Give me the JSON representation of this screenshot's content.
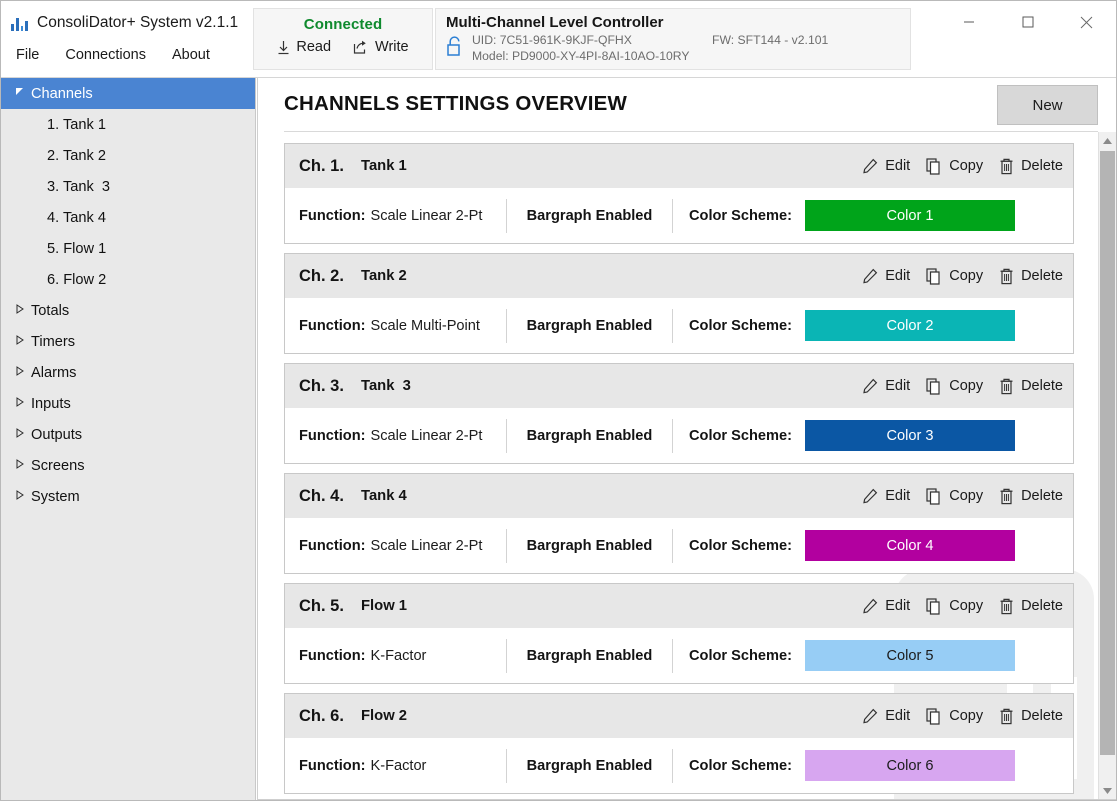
{
  "window": {
    "title": "ConsoliDator+ System v2.1.1",
    "logo_icon": "bar-chart-logo-icon",
    "minimize_icon": "minimize-icon",
    "maximize_icon": "maximize-icon",
    "close_icon": "close-icon"
  },
  "menubar": {
    "items": [
      {
        "label": "File"
      },
      {
        "label": "Connections"
      },
      {
        "label": "About"
      }
    ]
  },
  "connection": {
    "status": "Connected",
    "status_color": "#0f8a2e",
    "read_label": "Read",
    "read_icon": "download-arrow-icon",
    "write_label": "Write",
    "write_icon": "share-arrow-icon"
  },
  "device": {
    "name": "Multi-Channel Level Controller",
    "lock_icon": "unlocked-padlock-icon",
    "uid": "UID: 7C51-961K-9KJF-QFHX",
    "fw": "FW: SFT144 - v2.101",
    "model": "Model: PD9000-XY-4PI-8AI-10AO-10RY"
  },
  "sidebar": {
    "items": [
      {
        "label": "Channels",
        "arrow": "▲",
        "level": 0,
        "selected": true,
        "expanded": true
      },
      {
        "label": "1. Tank 1",
        "level": 1,
        "selected": false
      },
      {
        "label": "2. Tank 2",
        "level": 1,
        "selected": false
      },
      {
        "label": "3. Tank  3",
        "level": 1,
        "selected": false
      },
      {
        "label": "4. Tank 4",
        "level": 1,
        "selected": false
      },
      {
        "label": "5. Flow 1",
        "level": 1,
        "selected": false
      },
      {
        "label": "6. Flow 2",
        "level": 1,
        "selected": false
      },
      {
        "label": "Totals",
        "arrow": "▷",
        "level": 0,
        "selected": false,
        "expanded": false
      },
      {
        "label": "Timers",
        "arrow": "▷",
        "level": 0,
        "selected": false,
        "expanded": false
      },
      {
        "label": "Alarms",
        "arrow": "▷",
        "level": 0,
        "selected": false,
        "expanded": false
      },
      {
        "label": "Inputs",
        "arrow": "▷",
        "level": 0,
        "selected": false,
        "expanded": false
      },
      {
        "label": "Outputs",
        "arrow": "▷",
        "level": 0,
        "selected": false,
        "expanded": false
      },
      {
        "label": "Screens",
        "arrow": "▷",
        "level": 0,
        "selected": false,
        "expanded": false
      },
      {
        "label": "System",
        "arrow": "▷",
        "level": 0,
        "selected": false,
        "expanded": false
      }
    ]
  },
  "page": {
    "title": "CHANNELS SETTINGS OVERVIEW",
    "new_button": "New"
  },
  "card_labels": {
    "edit": "Edit",
    "copy": "Copy",
    "delete": "Delete",
    "edit_icon": "pencil-icon",
    "copy_icon": "copy-pages-icon",
    "delete_icon": "trash-can-icon",
    "function_label": "Function:",
    "color_label": "Color Scheme:"
  },
  "channels": [
    {
      "ch": "Ch. 1.",
      "name": "Tank 1",
      "function": "Scale Linear 2-Pt",
      "bargraph": "Bargraph Enabled",
      "color_name": "Color 1",
      "color_hex": "#00a41a",
      "color_text": "#ffffff"
    },
    {
      "ch": "Ch. 2.",
      "name": "Tank 2",
      "function": "Scale Multi-Point",
      "bargraph": "Bargraph Enabled",
      "color_name": "Color 2",
      "color_hex": "#0ab5b5",
      "color_text": "#ffffff"
    },
    {
      "ch": "Ch. 3.",
      "name": "Tank  3",
      "function": "Scale Linear 2-Pt",
      "bargraph": "Bargraph Enabled",
      "color_name": "Color 3",
      "color_hex": "#0b57a4",
      "color_text": "#ffffff"
    },
    {
      "ch": "Ch. 4.",
      "name": "Tank 4",
      "function": "Scale Linear 2-Pt",
      "bargraph": "Bargraph Enabled",
      "color_name": "Color 4",
      "color_hex": "#b2009f",
      "color_text": "#ffffff"
    },
    {
      "ch": "Ch. 5.",
      "name": "Flow 1",
      "function": "K-Factor",
      "bargraph": "Bargraph Enabled",
      "color_name": "Color 5",
      "color_hex": "#97cdf5",
      "color_text": "#1b1b1b"
    },
    {
      "ch": "Ch. 6.",
      "name": "Flow 2",
      "function": "K-Factor",
      "bargraph": "Bargraph Enabled",
      "color_name": "Color 6",
      "color_hex": "#d7a6f0",
      "color_text": "#1b1b1b"
    }
  ],
  "scrollbar": {
    "up_icon": "scroll-up-arrow-icon",
    "down_icon": "scroll-down-arrow-icon"
  }
}
